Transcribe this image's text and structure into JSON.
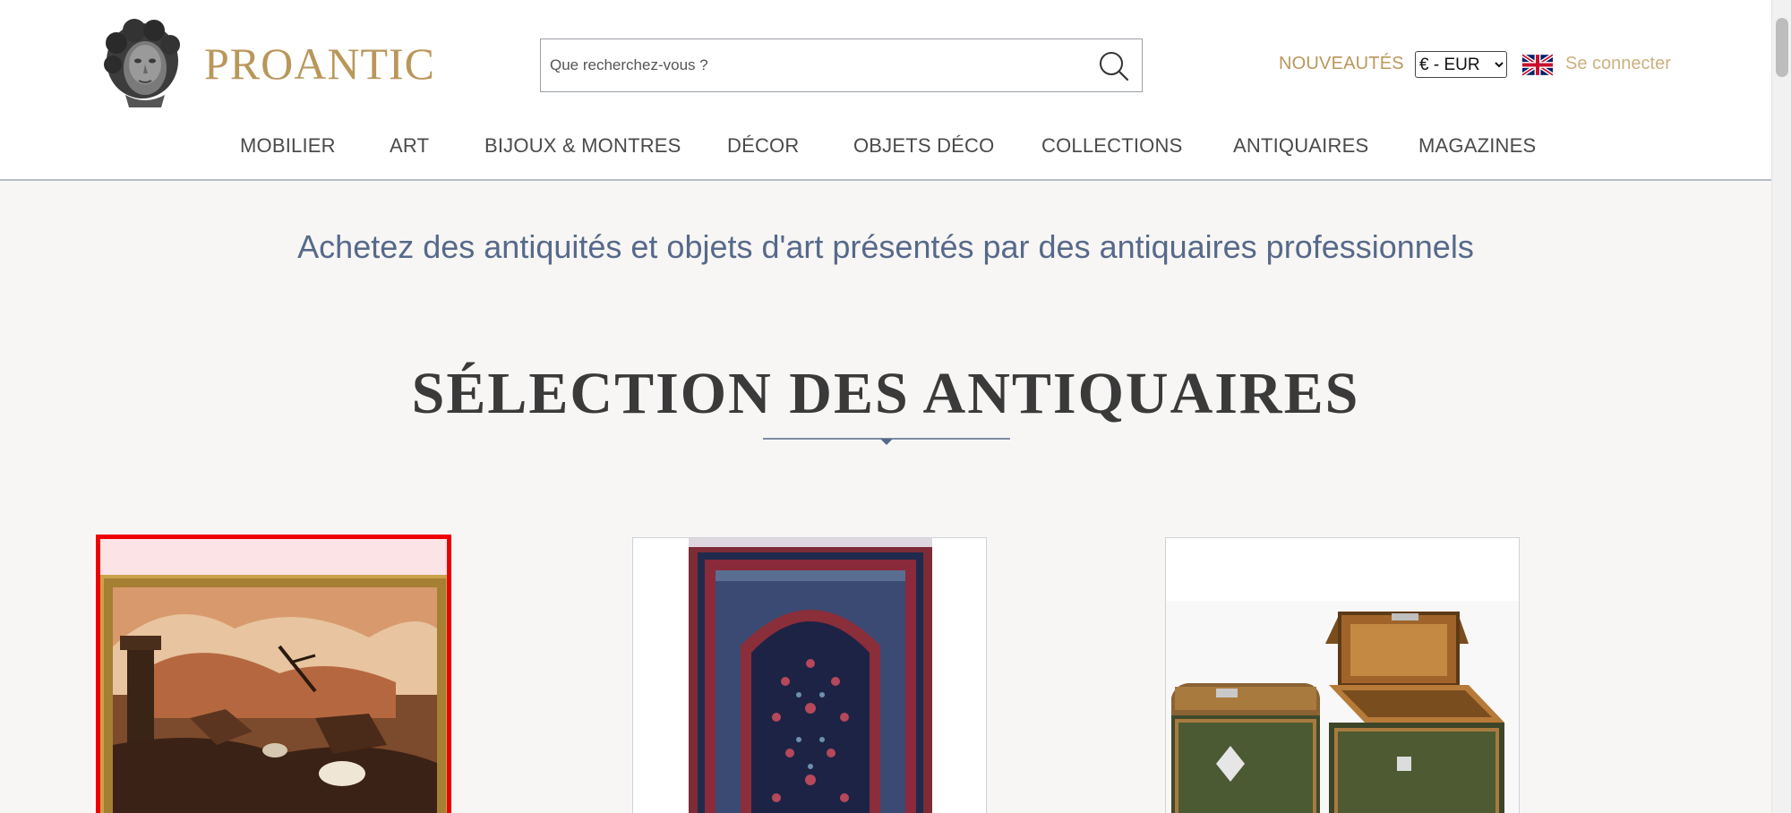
{
  "header": {
    "logo_text": "PROANTIC",
    "search": {
      "placeholder": "Que recherchez-vous ?"
    },
    "nouveautes": "NOUVEAUTÉS",
    "currency": {
      "selected": "€ - EUR",
      "options": [
        "€ - EUR"
      ]
    },
    "language_flag": "uk-flag-icon",
    "login": "Se connecter"
  },
  "nav": {
    "items": [
      {
        "label": "MOBILIER"
      },
      {
        "label": "ART"
      },
      {
        "label": "BIJOUX & MONTRES"
      },
      {
        "label": "DÉCOR"
      },
      {
        "label": "OBJETS DÉCO"
      },
      {
        "label": "COLLECTIONS"
      },
      {
        "label": "ANTIQUAIRES"
      },
      {
        "label": "MAGAZINES"
      }
    ]
  },
  "main": {
    "tagline": "Achetez des antiquités et objets d'art présentés par des antiquaires professionnels",
    "section_title": "SÉLECTION DES ANTIQUAIRES",
    "cards": [
      {
        "image": "framed-battle-painting",
        "highlighted": true
      },
      {
        "image": "persian-rug"
      },
      {
        "image": "marquetry-boxes"
      }
    ]
  },
  "colors": {
    "gold": "#b9975b",
    "navy": "#56698a",
    "highlight": "#ee0000"
  }
}
